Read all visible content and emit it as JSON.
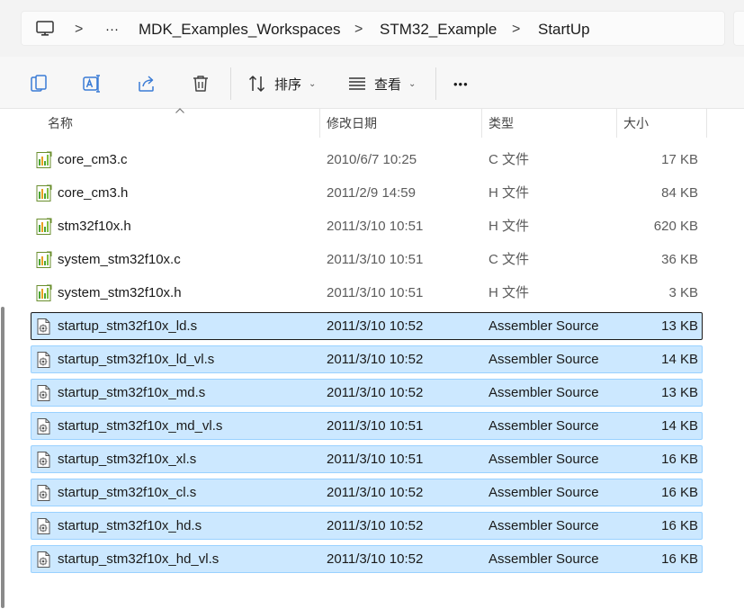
{
  "address": {
    "ellipsis": "···",
    "crumbs": [
      "MDK_Examples_Workspaces",
      "STM32_Example",
      "StartUp"
    ],
    "separator": ">"
  },
  "toolbar": {
    "sort_label": "排序",
    "view_label": "查看",
    "more_label": "•••"
  },
  "columns": {
    "name": "名称",
    "modified": "修改日期",
    "type": "类型",
    "size": "大小"
  },
  "files": [
    {
      "name": "core_cm3.c",
      "modified": "2010/6/7 10:25",
      "type": "C 文件",
      "size": "17 KB",
      "icon": "c-file-icon",
      "selected": false
    },
    {
      "name": "core_cm3.h",
      "modified": "2011/2/9 14:59",
      "type": "H 文件",
      "size": "84 KB",
      "icon": "h-file-icon",
      "selected": false
    },
    {
      "name": "stm32f10x.h",
      "modified": "2011/3/10 10:51",
      "type": "H 文件",
      "size": "620 KB",
      "icon": "h-file-icon",
      "selected": false
    },
    {
      "name": "system_stm32f10x.c",
      "modified": "2011/3/10 10:51",
      "type": "C 文件",
      "size": "36 KB",
      "icon": "c-file-icon",
      "selected": false
    },
    {
      "name": "system_stm32f10x.h",
      "modified": "2011/3/10 10:51",
      "type": "H 文件",
      "size": "3 KB",
      "icon": "h-file-icon",
      "selected": false
    },
    {
      "name": "startup_stm32f10x_ld.s",
      "modified": "2011/3/10 10:52",
      "type": "Assembler Source",
      "size": "13 KB",
      "icon": "assembler-file-icon",
      "selected": true,
      "focused": true
    },
    {
      "name": "startup_stm32f10x_ld_vl.s",
      "modified": "2011/3/10 10:52",
      "type": "Assembler Source",
      "size": "14 KB",
      "icon": "assembler-file-icon",
      "selected": true
    },
    {
      "name": "startup_stm32f10x_md.s",
      "modified": "2011/3/10 10:52",
      "type": "Assembler Source",
      "size": "13 KB",
      "icon": "assembler-file-icon",
      "selected": true
    },
    {
      "name": "startup_stm32f10x_md_vl.s",
      "modified": "2011/3/10 10:51",
      "type": "Assembler Source",
      "size": "14 KB",
      "icon": "assembler-file-icon",
      "selected": true
    },
    {
      "name": "startup_stm32f10x_xl.s",
      "modified": "2011/3/10 10:51",
      "type": "Assembler Source",
      "size": "16 KB",
      "icon": "assembler-file-icon",
      "selected": true
    },
    {
      "name": "startup_stm32f10x_cl.s",
      "modified": "2011/3/10 10:52",
      "type": "Assembler Source",
      "size": "16 KB",
      "icon": "assembler-file-icon",
      "selected": true
    },
    {
      "name": "startup_stm32f10x_hd.s",
      "modified": "2011/3/10 10:52",
      "type": "Assembler Source",
      "size": "16 KB",
      "icon": "assembler-file-icon",
      "selected": true
    },
    {
      "name": "startup_stm32f10x_hd_vl.s",
      "modified": "2011/3/10 10:52",
      "type": "Assembler Source",
      "size": "16 KB",
      "icon": "assembler-file-icon",
      "selected": true
    }
  ],
  "colors": {
    "selection_bg": "#cce8ff",
    "selection_border": "#99d1ff",
    "focus_border": "#1a1a1a"
  }
}
